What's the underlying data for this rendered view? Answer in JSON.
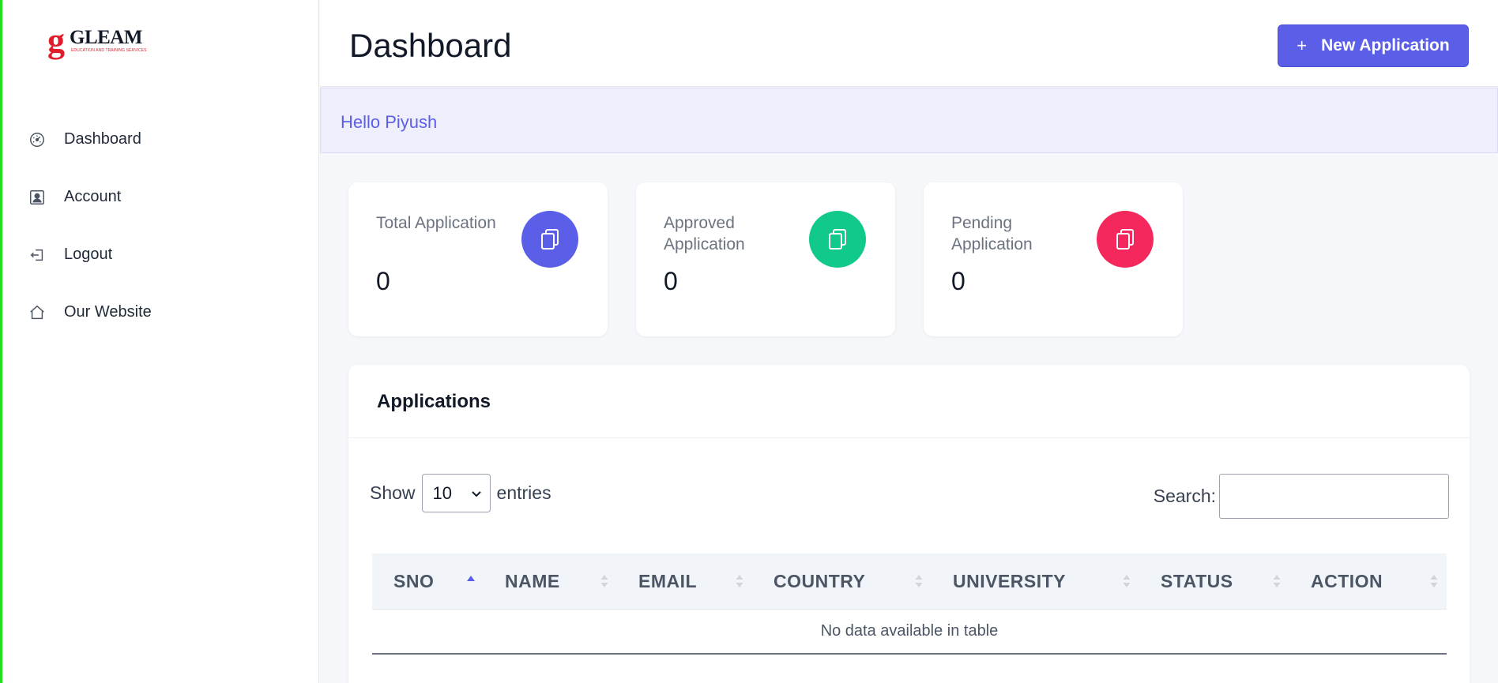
{
  "brand": {
    "logo_letter": "g",
    "logo_word": "GLEAM",
    "logo_tagline": "EDUCATION AND TRAINING SERVICES"
  },
  "sidebar": {
    "items": [
      {
        "label": "Dashboard",
        "icon": "gauge-icon"
      },
      {
        "label": "Account",
        "icon": "user-card-icon"
      },
      {
        "label": "Logout",
        "icon": "logout-icon"
      },
      {
        "label": "Our Website",
        "icon": "home-icon"
      }
    ]
  },
  "header": {
    "title": "Dashboard",
    "new_button": {
      "icon": "+",
      "label": "New Application"
    }
  },
  "greeting": "Hello Piyush",
  "stats": [
    {
      "title": "Total Application",
      "value": "0",
      "icon": "copy-icon",
      "color": "#5b5fe8"
    },
    {
      "title": "Approved Application",
      "value": "0",
      "icon": "copy-icon",
      "color": "#10c98a"
    },
    {
      "title": "Pending Application",
      "value": "0",
      "icon": "copy-icon",
      "color": "#f5285e"
    }
  ],
  "applications": {
    "title": "Applications",
    "show_label": "Show",
    "entries_value": "10",
    "entries_label": "entries",
    "search_label": "Search:",
    "search_value": "",
    "columns": [
      "SNO",
      "NAME",
      "EMAIL",
      "COUNTRY",
      "UNIVERSITY",
      "STATUS",
      "ACTION"
    ],
    "sorted_column": "SNO",
    "sort_direction": "ascending",
    "empty_message": "No data available in table"
  },
  "colors": {
    "accent": "#5b5fe8",
    "banner_bg": "#efeefc",
    "green": "#10c98a",
    "red": "#f5285e"
  }
}
